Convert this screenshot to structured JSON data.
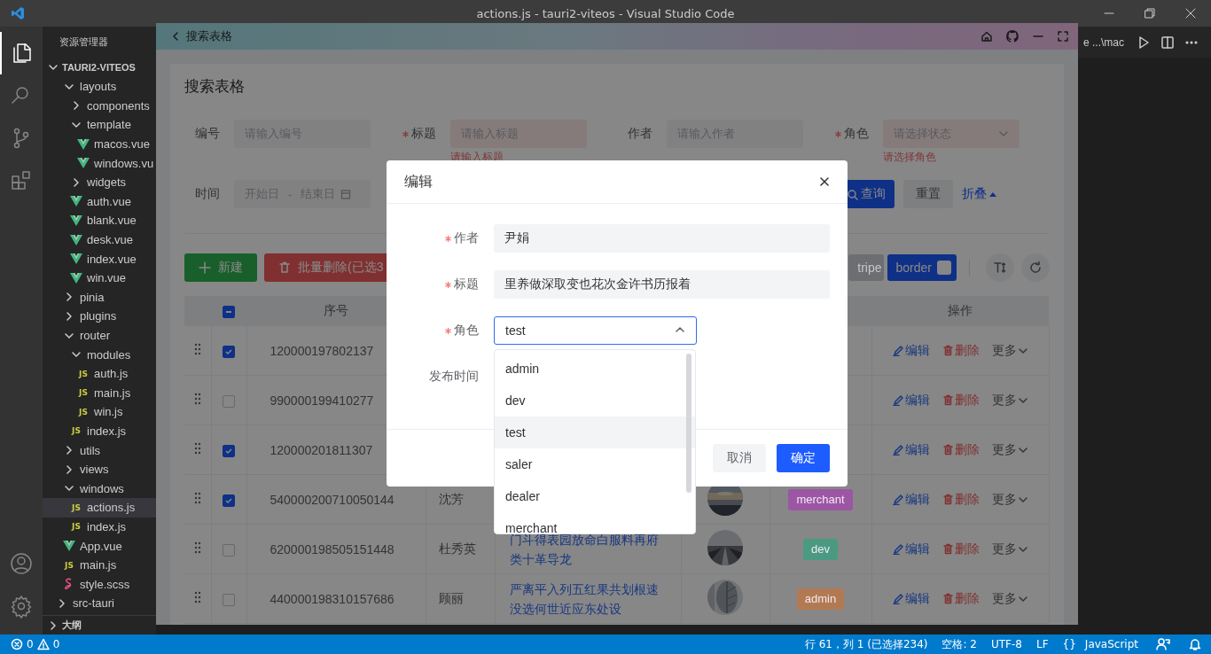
{
  "window": {
    "title": "actions.js - tauri2-viteos - Visual Studio Code"
  },
  "activity_bar": {
    "top": [
      {
        "kind": "files",
        "selected": true
      },
      {
        "kind": "search",
        "selected": false
      },
      {
        "kind": "source-control",
        "selected": false
      },
      {
        "kind": "extensions",
        "selected": false
      }
    ],
    "bottom": [
      {
        "kind": "account",
        "selected": false
      },
      {
        "kind": "settings",
        "selected": false
      }
    ]
  },
  "explorer": {
    "title": "资源管理器",
    "project": {
      "label": "TAURI2-VITEOS",
      "expanded": true
    },
    "items": [
      {
        "label": "layouts",
        "kind": "folder",
        "expanded": true,
        "selected": false,
        "children": [
          {
            "label": "components",
            "kind": "folder",
            "expanded": false,
            "selected": false
          },
          {
            "label": "template",
            "kind": "folder",
            "expanded": true,
            "selected": false,
            "children": [
              {
                "label": "macos.vue",
                "kind": "vue",
                "selected": false
              },
              {
                "label": "windows.vu",
                "kind": "vue",
                "selected": false
              }
            ]
          },
          {
            "label": "widgets",
            "kind": "folder",
            "expanded": false,
            "selected": false
          },
          {
            "label": "auth.vue",
            "kind": "vue",
            "selected": false
          },
          {
            "label": "blank.vue",
            "kind": "vue",
            "selected": false
          },
          {
            "label": "desk.vue",
            "kind": "vue",
            "selected": false
          },
          {
            "label": "index.vue",
            "kind": "vue",
            "selected": false
          },
          {
            "label": "win.vue",
            "kind": "vue",
            "selected": false
          }
        ]
      },
      {
        "label": "pinia",
        "kind": "folder",
        "expanded": false,
        "selected": false
      },
      {
        "label": "plugins",
        "kind": "folder",
        "expanded": false,
        "selected": false
      },
      {
        "label": "router",
        "kind": "folder",
        "expanded": true,
        "selected": false,
        "children": [
          {
            "label": "modules",
            "kind": "folder",
            "expanded": true,
            "selected": false,
            "children": [
              {
                "label": "auth.js",
                "kind": "js",
                "icon_text": "JS",
                "selected": false
              },
              {
                "label": "main.js",
                "kind": "js",
                "icon_text": "JS",
                "selected": false
              },
              {
                "label": "win.js",
                "kind": "js",
                "icon_text": "JS",
                "selected": false
              }
            ]
          },
          {
            "label": "index.js",
            "kind": "js",
            "icon_text": "JS",
            "selected": false
          }
        ]
      },
      {
        "label": "utils",
        "kind": "folder",
        "expanded": false,
        "selected": false
      },
      {
        "label": "views",
        "kind": "folder",
        "expanded": false,
        "selected": false
      },
      {
        "label": "windows",
        "kind": "folder",
        "expanded": true,
        "selected": false,
        "children": [
          {
            "label": "actions.js",
            "kind": "js",
            "icon_text": "JS",
            "selected": true
          },
          {
            "label": "index.js",
            "kind": "js",
            "icon_text": "JS",
            "selected": false
          }
        ]
      },
      {
        "label": "App.vue",
        "kind": "vue",
        "selected": false
      },
      {
        "label": "main.js",
        "kind": "js",
        "icon_text": "JS",
        "selected": false
      },
      {
        "label": "style.scss",
        "kind": "scss",
        "selected": false
      }
    ],
    "root_items": [
      {
        "label": "src-tauri",
        "kind": "folder",
        "expanded": false,
        "selected": false
      }
    ],
    "outline": {
      "label": "大纲",
      "expanded": false
    }
  },
  "editor": {
    "tab_text": "e ...\\mac"
  },
  "app": {
    "header": {
      "back_label": "搜索表格"
    },
    "card_title": "搜索表格",
    "search_fields": [
      {
        "label": "编号",
        "required": false,
        "placeholder": "请输入编号",
        "kind": "input"
      },
      {
        "label": "标题",
        "required": true,
        "placeholder": "请输入标题",
        "error": "请输入标题",
        "kind": "input"
      },
      {
        "label": "作者",
        "required": false,
        "placeholder": "请输入作者",
        "kind": "input"
      },
      {
        "label": "角色",
        "required": true,
        "placeholder": "请选择状态",
        "error": "请选择角色",
        "kind": "select"
      },
      {
        "label": "时间",
        "required": false,
        "kind": "daterange",
        "start_placeholder": "开始日",
        "separator": "-",
        "end_placeholder": "结束日"
      }
    ],
    "search_buttons": {
      "query": "查询",
      "reset": "重置",
      "collapse": "折叠"
    },
    "toolbar": {
      "create": "新建",
      "batch_delete": "批量删除(已选3",
      "stripe": "tripe",
      "stripe_on": false,
      "border": "border",
      "border_on": false
    },
    "table": {
      "header_checkbox": {
        "indeterminate": true
      },
      "number_header": "序号",
      "actions_header": "操作",
      "rows": [
        {
          "checked": true,
          "number": "120000197802137",
          "actions": {
            "edit": "编辑",
            "delete": "删除",
            "more": "更多"
          }
        },
        {
          "checked": false,
          "number": "990000199410277",
          "actions": {
            "edit": "编辑",
            "delete": "删除",
            "more": "更多"
          }
        },
        {
          "checked": true,
          "number": "120000201811307",
          "actions": {
            "edit": "编辑",
            "delete": "删除",
            "more": "更多"
          }
        },
        {
          "checked": true,
          "number": "540000200710050144",
          "author": "沈芳",
          "tag": {
            "label": "merchant",
            "color": "#9c56a4"
          },
          "actions": {
            "edit": "编辑",
            "delete": "删除",
            "more": "更多"
          }
        },
        {
          "checked": false,
          "number": "620000198505151448",
          "author": "杜秀英",
          "title": "门斗得表园放命白服料再府类十革导龙",
          "tag": {
            "label": "dev",
            "color": "#4a9a82"
          },
          "actions": {
            "edit": "编辑",
            "delete": "删除",
            "more": "更多"
          }
        },
        {
          "checked": false,
          "number": "440000198310157686",
          "author": "顾丽",
          "title": "严离平入列五红果共划根速没选何世近应东处设",
          "tag": {
            "label": "admin",
            "color": "#b27a52"
          },
          "actions": {
            "edit": "编辑",
            "delete": "删除",
            "more": "更多"
          }
        }
      ]
    },
    "dialog": {
      "title": "编辑",
      "fields": [
        {
          "label": "作者",
          "required": true,
          "kind": "input",
          "value": "尹娟"
        },
        {
          "label": "标题",
          "required": true,
          "kind": "input",
          "value": "里养做深取变也花次金许书历报着"
        },
        {
          "label": "角色",
          "required": true,
          "kind": "select",
          "value": "test",
          "open": true
        },
        {
          "label": "发布时间",
          "required": false
        }
      ],
      "options": [
        {
          "label": "admin",
          "highlighted": false
        },
        {
          "label": "dev",
          "highlighted": false
        },
        {
          "label": "test",
          "highlighted": true
        },
        {
          "label": "saler",
          "highlighted": false
        },
        {
          "label": "dealer",
          "highlighted": false
        },
        {
          "label": "merchant",
          "highlighted": false
        }
      ],
      "cancel": "取消",
      "confirm": "确定"
    }
  },
  "status_bar": {
    "errors": "0",
    "warnings": "0",
    "items": [
      "行 61，列 1 (已选择234)",
      "空格: 2",
      "UTF-8",
      "LF"
    ],
    "language_icon": "{}",
    "language": "JavaScript"
  }
}
